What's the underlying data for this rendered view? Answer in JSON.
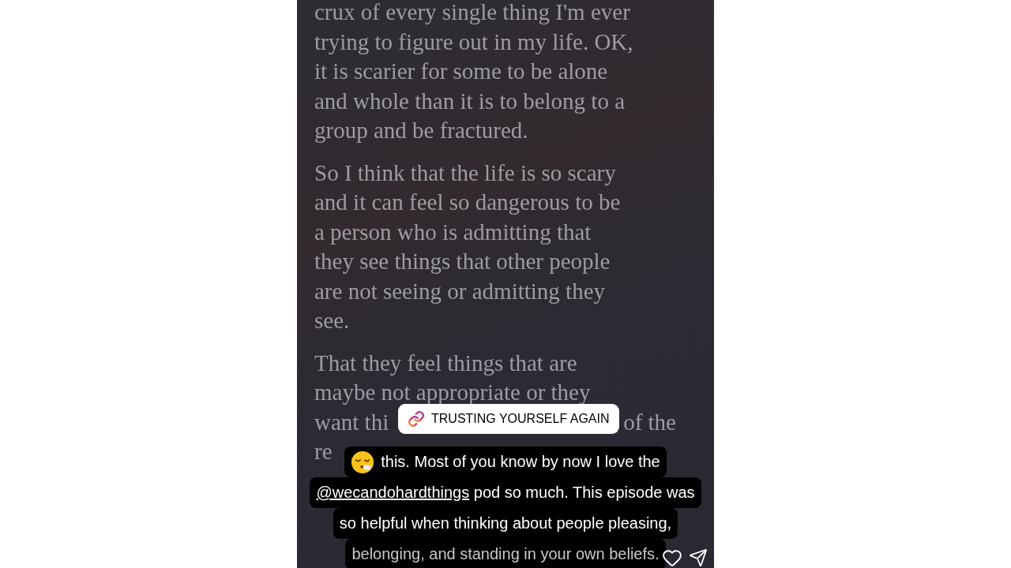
{
  "story": {
    "paragraphs": [
      {
        "lines": [
          [
            "crux of every single thing I'm ever"
          ],
          [
            "trying to figure out in my life. OK,"
          ],
          [
            "it is scarier for some to be alone"
          ],
          [
            "and whole than it is to belong to a"
          ],
          [
            "group and be fractured."
          ]
        ]
      },
      {
        "lines": [
          [
            "So I think that the life is so scary"
          ],
          [
            "and it can feel so dangerous to be"
          ],
          [
            "a person who is admitting that"
          ],
          [
            "they see things that other people"
          ],
          [
            "are not seeing or admitting they"
          ],
          [
            "see."
          ]
        ]
      },
      {
        "lines": [
          [
            "That they feel things that are"
          ],
          [
            "maybe not appropriate or they"
          ],
          [
            "want thi",
            "of the"
          ],
          [
            "re"
          ]
        ]
      }
    ]
  },
  "link_sticker": {
    "label": "TRUSTING YOURSELF AGAIN"
  },
  "caption": {
    "lines": [
      {
        "segments": [
          {
            "kind": "emoji"
          },
          {
            "kind": "text",
            "text": "this. Most of you know by now I love the"
          }
        ]
      },
      {
        "segments": [
          {
            "kind": "mention",
            "text": "@wecandohardthings"
          },
          {
            "kind": "text",
            "text": " pod so much. This episode was"
          }
        ]
      },
      {
        "segments": [
          {
            "kind": "text",
            "text": "so helpful when thinking about people pleasing,"
          }
        ]
      },
      {
        "segments": [
          {
            "kind": "text",
            "text": "belonging, and standing in your own beliefs."
          }
        ]
      }
    ]
  }
}
